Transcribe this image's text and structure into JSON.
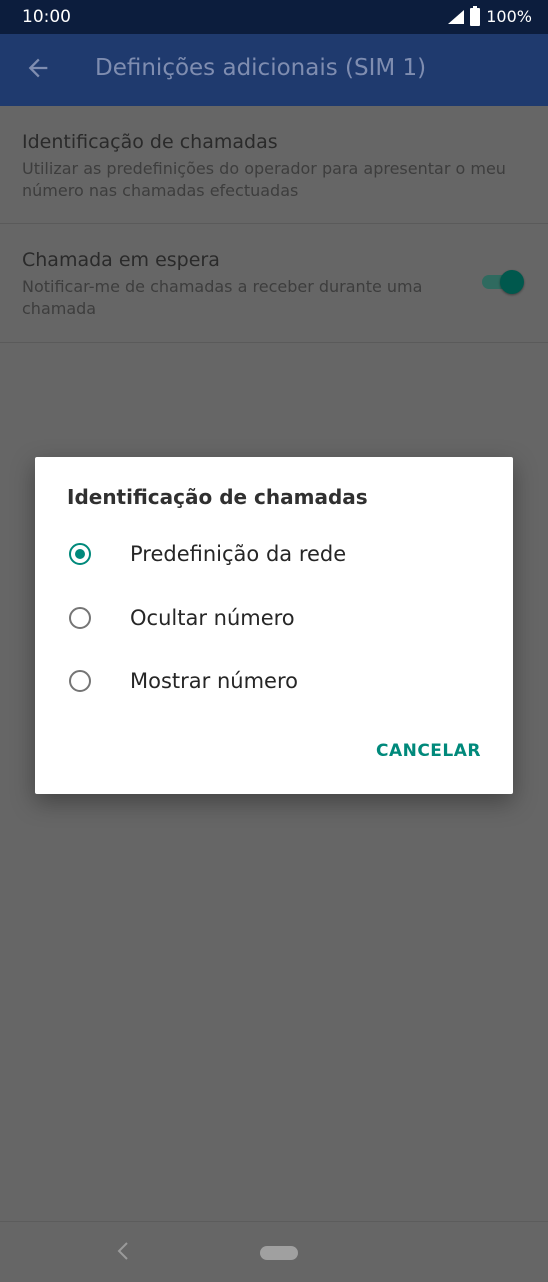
{
  "status_bar": {
    "time": "10:00",
    "battery": "100%"
  },
  "app_bar": {
    "title": "Definições adicionais (SIM 1)"
  },
  "preferences": [
    {
      "title": "Identificação de chamadas",
      "summary": "Utilizar as predefinições do operador para apresentar o meu número nas chamadas efectuadas"
    },
    {
      "title": "Chamada em espera",
      "summary": "Notificar-me de chamadas a receber durante uma chamada",
      "toggle_on": true
    }
  ],
  "dialog": {
    "title": "Identificação de chamadas",
    "options": [
      {
        "label": "Predefinição da rede",
        "selected": true
      },
      {
        "label": "Ocultar número",
        "selected": false
      },
      {
        "label": "Mostrar número",
        "selected": false
      }
    ],
    "cancel_label": "CANCELAR"
  },
  "colors": {
    "accent": "#00897b",
    "app_bar": "#1f3a6e",
    "status_bar": "#0c1d3d"
  }
}
